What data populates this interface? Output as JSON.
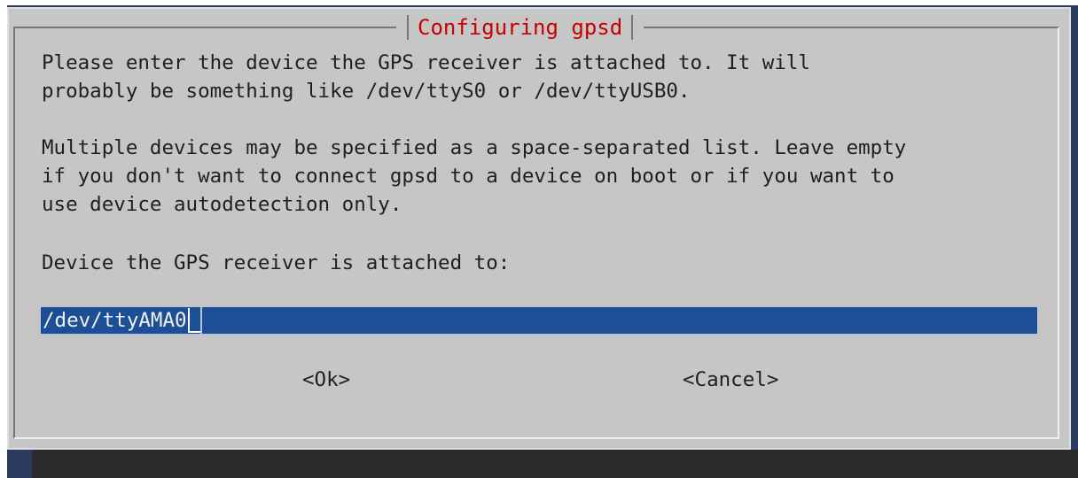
{
  "dialog": {
    "title": "Configuring gpsd",
    "paragraph1": [
      "Please enter the device the GPS receiver is attached to. It will",
      "probably be something like /dev/ttyS0 or /dev/ttyUSB0."
    ],
    "paragraph2": [
      "Multiple devices may be specified as a space-separated list. Leave empty",
      "if you don't want to connect gpsd to a device on boot or if you want to",
      "use device autodetection only."
    ],
    "prompt": "Device the GPS receiver is attached to:",
    "input": {
      "value": "/dev/ttyAMA0"
    },
    "buttons": {
      "ok": "<Ok>",
      "cancel": "<Cancel>"
    }
  },
  "colors": {
    "dialog_bg": "#c6c6c6",
    "title": "#c80000",
    "input_bg": "#1d4f96",
    "terminal_bg": "#2a3a61"
  }
}
